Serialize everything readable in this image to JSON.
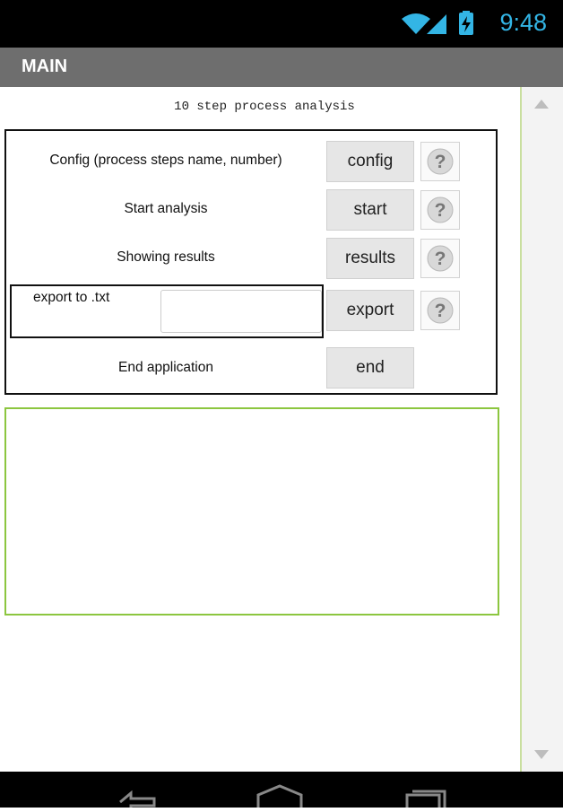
{
  "status_bar": {
    "time": "9:48",
    "icons": [
      "wifi-icon",
      "signal-icon",
      "battery-charging-icon"
    ],
    "accent_color": "#33b5e5"
  },
  "title_bar": {
    "title": "MAIN"
  },
  "main": {
    "subtitle": "10 step process analysis",
    "rows": [
      {
        "label": "Config (process steps name, number)",
        "button": "config",
        "has_help": true
      },
      {
        "label": "Start analysis",
        "button": "start",
        "has_help": true
      },
      {
        "label": "Showing results",
        "button": "results",
        "has_help": true
      },
      {
        "label": "export to .txt",
        "button": "export",
        "has_help": true,
        "input_value": ""
      },
      {
        "label": "End application",
        "button": "end",
        "has_help": false
      }
    ],
    "help_glyph": "?"
  },
  "nav_bar": {
    "icons": [
      "back-icon",
      "home-icon",
      "recents-icon"
    ]
  },
  "colors": {
    "status_bar": "#000000",
    "title_bar": "#6e6e6e",
    "output_border": "#8cc63f"
  }
}
